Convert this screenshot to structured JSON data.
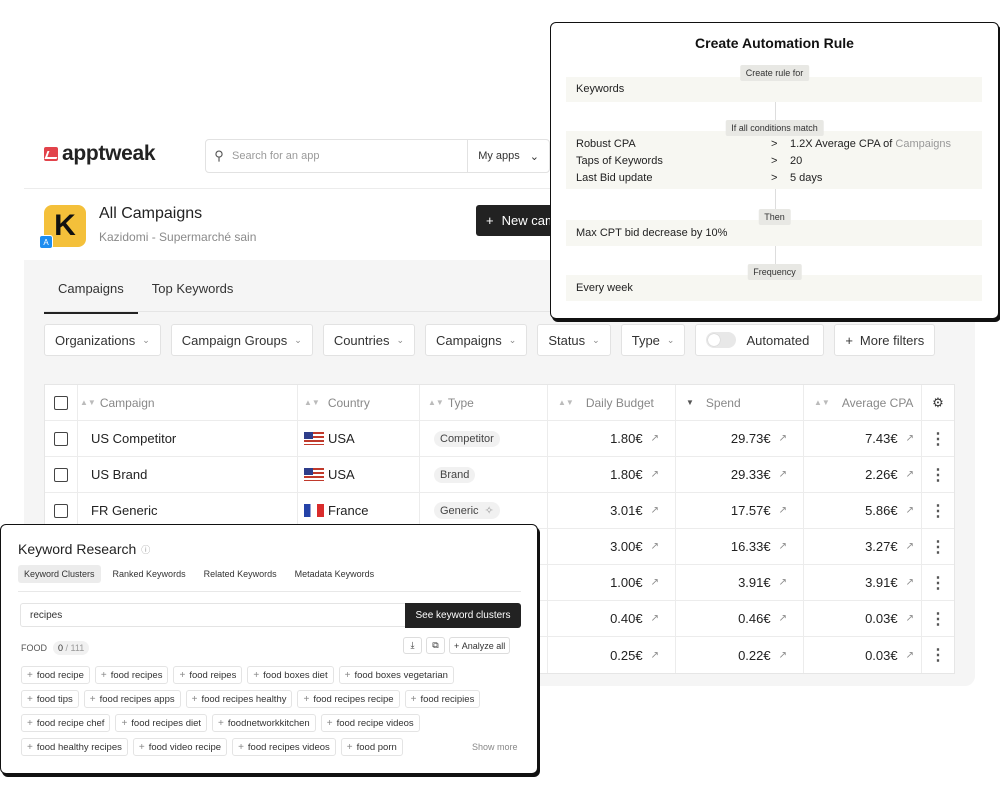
{
  "app": {
    "logo_text": "apptweak",
    "search": {
      "placeholder": "Search for an app"
    },
    "my_apps_label": "My apps",
    "title": "All Campaigns",
    "subtitle": "Kazidomi - Supermarché sain",
    "icon_letter": "K",
    "new_campaign_label": "New campaign"
  },
  "tabs": [
    {
      "label": "Campaigns",
      "active": true
    },
    {
      "label": "Top Keywords",
      "active": false
    }
  ],
  "filters": {
    "organizations": "Organizations",
    "campaign_groups": "Campaign Groups",
    "countries": "Countries",
    "campaigns": "Campaigns",
    "status": "Status",
    "type": "Type",
    "automated": "Automated",
    "more_filters": "More filters"
  },
  "table": {
    "headers": {
      "campaign": "Campaign",
      "country": "Country",
      "type": "Type",
      "daily_budget": "Daily Budget",
      "spend": "Spend",
      "average_cpa": "Average CPA"
    },
    "rows": [
      {
        "campaign": "US Competitor",
        "country": "USA",
        "type": "Competitor",
        "budget": "1.80€",
        "spend": "29.73€",
        "cpa": "7.43€"
      },
      {
        "campaign": "US Brand",
        "country": "USA",
        "type": "Brand",
        "budget": "1.80€",
        "spend": "29.33€",
        "cpa": "2.26€"
      },
      {
        "campaign": "FR Generic",
        "country": "France",
        "type": "Generic",
        "budget": "3.01€",
        "spend": "17.57€",
        "cpa": "5.86€"
      },
      {
        "budget": "3.00€",
        "spend": "16.33€",
        "cpa": "3.27€"
      },
      {
        "budget": "1.00€",
        "spend": "3.91€",
        "cpa": "3.91€"
      },
      {
        "budget": "0.40€",
        "spend": "0.46€",
        "cpa": "0.03€"
      },
      {
        "budget": "0.25€",
        "spend": "0.22€",
        "cpa": "0.03€"
      }
    ]
  },
  "rule": {
    "title": "Create Automation Rule",
    "tag_for": "Create rule for",
    "target": "Keywords",
    "tag_conditions": "If all conditions match",
    "conditions": [
      {
        "key": "Robust CPA",
        "op": ">",
        "value": "1.2X Average CPA of",
        "value_ref": "Campaigns"
      },
      {
        "key": "Taps of Keywords",
        "op": ">",
        "value": "20",
        "value_ref": ""
      },
      {
        "key": "Last Bid update",
        "op": ">",
        "value": "5 days",
        "value_ref": ""
      }
    ],
    "tag_then": "Then",
    "action": "Max CPT bid decrease by 10%",
    "tag_frequency": "Frequency",
    "frequency": "Every week"
  },
  "keyword_research": {
    "title": "Keyword Research",
    "tabs": [
      "Keyword Clusters",
      "Ranked Keywords",
      "Related Keywords",
      "Metadata Keywords"
    ],
    "search_value": "recipes",
    "see_clusters": "See keyword clusters",
    "group_label": "FOOD",
    "count_selected": "0",
    "count_total": "111",
    "analyze_all": "Analyze all",
    "chips": [
      [
        "food recipe",
        "food recipes",
        "food reipes",
        "food boxes diet",
        "food boxes vegetarian"
      ],
      [
        "food tips",
        "food recipes apps",
        "food recipes healthy",
        "food recipes recipe",
        "food recipies"
      ],
      [
        "food recipe chef",
        "food recipes diet",
        "foodnetworkkitchen",
        "food recipe videos"
      ],
      [
        "food healthy recipes",
        "food video recipe",
        "food recipes videos",
        "food porn"
      ]
    ],
    "show_more": "Show more"
  }
}
